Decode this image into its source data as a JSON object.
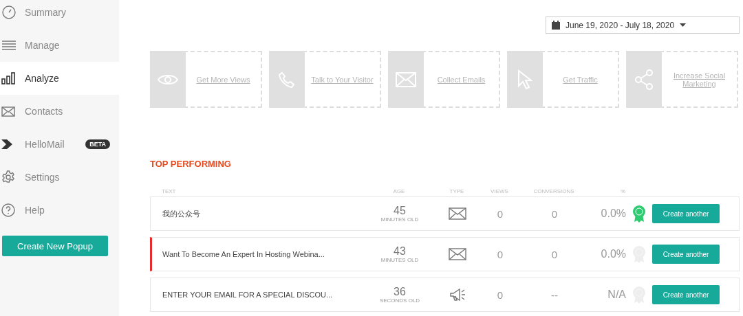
{
  "sidebar": {
    "items": [
      {
        "label": "Summary",
        "kind": "gauge",
        "selected": false
      },
      {
        "label": "Manage",
        "kind": "list",
        "selected": false
      },
      {
        "label": "Analyze",
        "kind": "bars",
        "selected": true
      },
      {
        "label": "Contacts",
        "kind": "envelope",
        "selected": false
      },
      {
        "label": "HelloMail",
        "kind": "arrow",
        "selected": false,
        "badge": "BETA"
      },
      {
        "label": "Settings",
        "kind": "gear",
        "selected": false
      },
      {
        "label": "Help",
        "kind": "help",
        "selected": false
      }
    ],
    "create_button": "Create New Popup"
  },
  "date_range": "June 19, 2020 - July 18, 2020",
  "goal_cards": [
    {
      "label": "Get More Views",
      "kind": "eye"
    },
    {
      "label": "Talk to Your Visitor",
      "kind": "phone"
    },
    {
      "label": "Collect Emails",
      "kind": "envelope"
    },
    {
      "label": "Get Traffic",
      "kind": "cursor"
    },
    {
      "label": "Increase Social Marketing",
      "kind": "share"
    }
  ],
  "top_performing": {
    "title": "TOP PERFORMING",
    "columns": [
      "TEXT",
      "AGE",
      "TYPE",
      "VIEWS",
      "CONVERSIONS",
      "%"
    ],
    "rows": [
      {
        "text": "我的公众号",
        "age": "45",
        "age_unit": "MINUTES OLD",
        "kind": "email",
        "views": "0",
        "conversions": "0",
        "percent": "0.0%",
        "winner": true,
        "flagged": false,
        "button": "Create another"
      },
      {
        "text": "Want To Become An Expert In Hosting Webina...",
        "age": "43",
        "age_unit": "MINUTES OLD",
        "kind": "email",
        "views": "0",
        "conversions": "0",
        "percent": "0.0%",
        "winner": false,
        "flagged": true,
        "button": "Create another"
      },
      {
        "text": "ENTER YOUR EMAIL FOR A SPECIAL DISCOU...",
        "age": "36",
        "age_unit": "SECONDS OLD",
        "kind": "announcement",
        "views": "0",
        "conversions": "--",
        "percent": "N/A",
        "winner": false,
        "flagged": false,
        "button": "Create another"
      }
    ]
  }
}
